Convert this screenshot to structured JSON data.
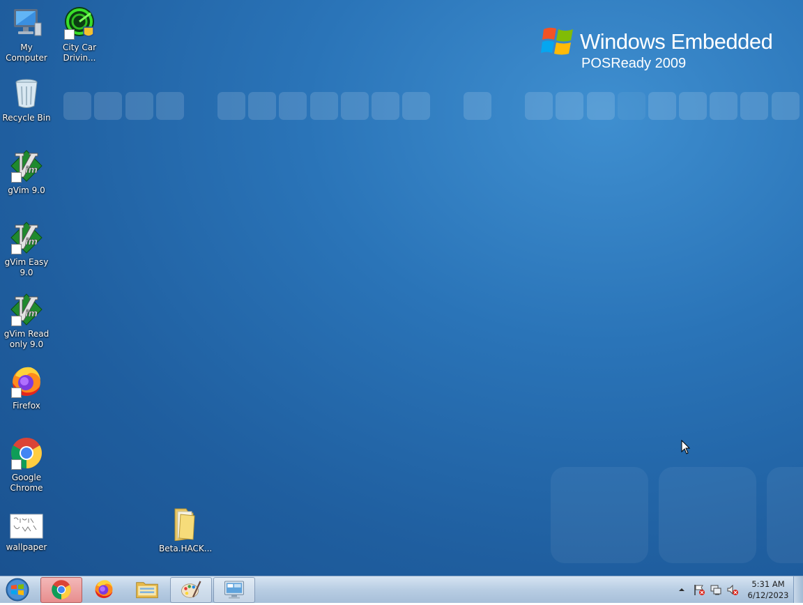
{
  "brand": {
    "line1": "Windows Embedded",
    "line2": "POSReady 2009"
  },
  "desktop_icons": [
    {
      "label": "My\nComputer",
      "icon": "computer-icon"
    },
    {
      "label": "City Car\nDrivin...",
      "icon": "city-car-driving-icon"
    },
    {
      "label": "Recycle Bin",
      "icon": "recycle-bin-icon"
    },
    {
      "label": "gVim 9.0",
      "icon": "gvim-icon"
    },
    {
      "label": "gVim Easy 9.0",
      "icon": "gvim-icon"
    },
    {
      "label": "gVim Read\nonly 9.0",
      "icon": "gvim-icon"
    },
    {
      "label": "Firefox",
      "icon": "firefox-icon"
    },
    {
      "label": "Google\nChrome",
      "icon": "chrome-icon"
    },
    {
      "label": "wallpaper",
      "icon": "image-file-icon"
    },
    {
      "label": "Beta.HACK...",
      "icon": "folder-icon"
    }
  ],
  "taskbar": {
    "items": [
      {
        "name": "Google Chrome",
        "icon": "chrome-icon",
        "state": "highlighted"
      },
      {
        "name": "Firefox",
        "icon": "firefox-icon",
        "state": "normal"
      },
      {
        "name": "Windows Explorer",
        "icon": "folder-icon",
        "state": "normal"
      },
      {
        "name": "Paint",
        "icon": "paint-icon",
        "state": "active"
      },
      {
        "name": "Remote Desktop",
        "icon": "remote-desktop-icon",
        "state": "active"
      }
    ],
    "tray_icons": [
      "show-hidden-icons",
      "action-center-flag-icon",
      "network-icon",
      "volume-muted-icon"
    ],
    "time": "5:31 AM",
    "date": "6/12/2023"
  },
  "colors": {
    "desktop_bg": "#2a74b8",
    "taskbar_bg": "#b8cde3",
    "icon_label": "#ffffff"
  }
}
